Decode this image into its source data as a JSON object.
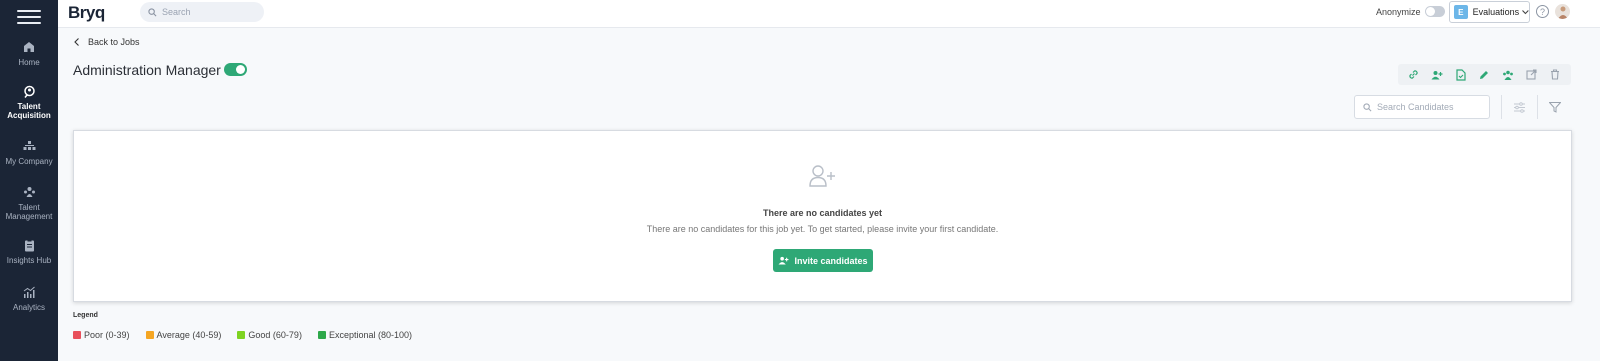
{
  "app": {
    "brand": "Bryq",
    "search_placeholder": "Search",
    "anonymize_label": "Anonymize",
    "evaluations": {
      "badge": "E",
      "label": "Evaluations"
    },
    "help_symbol": "?"
  },
  "sidebar": {
    "items": [
      {
        "label": "Home",
        "icon": "home-icon"
      },
      {
        "label": "Talent Acquisition",
        "icon": "talent-acquisition-icon",
        "active": true
      },
      {
        "label": "My Company",
        "icon": "company-icon"
      },
      {
        "label": "Talent Management",
        "icon": "talent-management-icon"
      },
      {
        "label": "Insights Hub",
        "icon": "clipboard-icon"
      },
      {
        "label": "Analytics",
        "icon": "analytics-icon"
      }
    ]
  },
  "job": {
    "back_label": "Back to Jobs",
    "title": "Administration Manager",
    "active": true
  },
  "toolbar": {
    "actions": [
      "link-icon",
      "add-user-icon",
      "document-icon",
      "edit-icon",
      "team-icon",
      "export-icon",
      "trash-icon"
    ],
    "search_placeholder": "Search Candidates"
  },
  "empty_state": {
    "title": "There are no candidates yet",
    "description": "There are no candidates for this job yet. To get started, please invite your first candidate.",
    "button_label": "Invite candidates"
  },
  "legend": {
    "title": "Legend",
    "items": [
      {
        "label": "Poor (0-39)",
        "color": "#e8505b"
      },
      {
        "label": "Average (40-59)",
        "color": "#f5a623"
      },
      {
        "label": "Good (60-79)",
        "color": "#7ed321"
      },
      {
        "label": "Exceptional (80-100)",
        "color": "#2ea84a"
      }
    ]
  },
  "colors": {
    "sidebar_bg": "#1b2536",
    "accent": "#2ea876"
  }
}
